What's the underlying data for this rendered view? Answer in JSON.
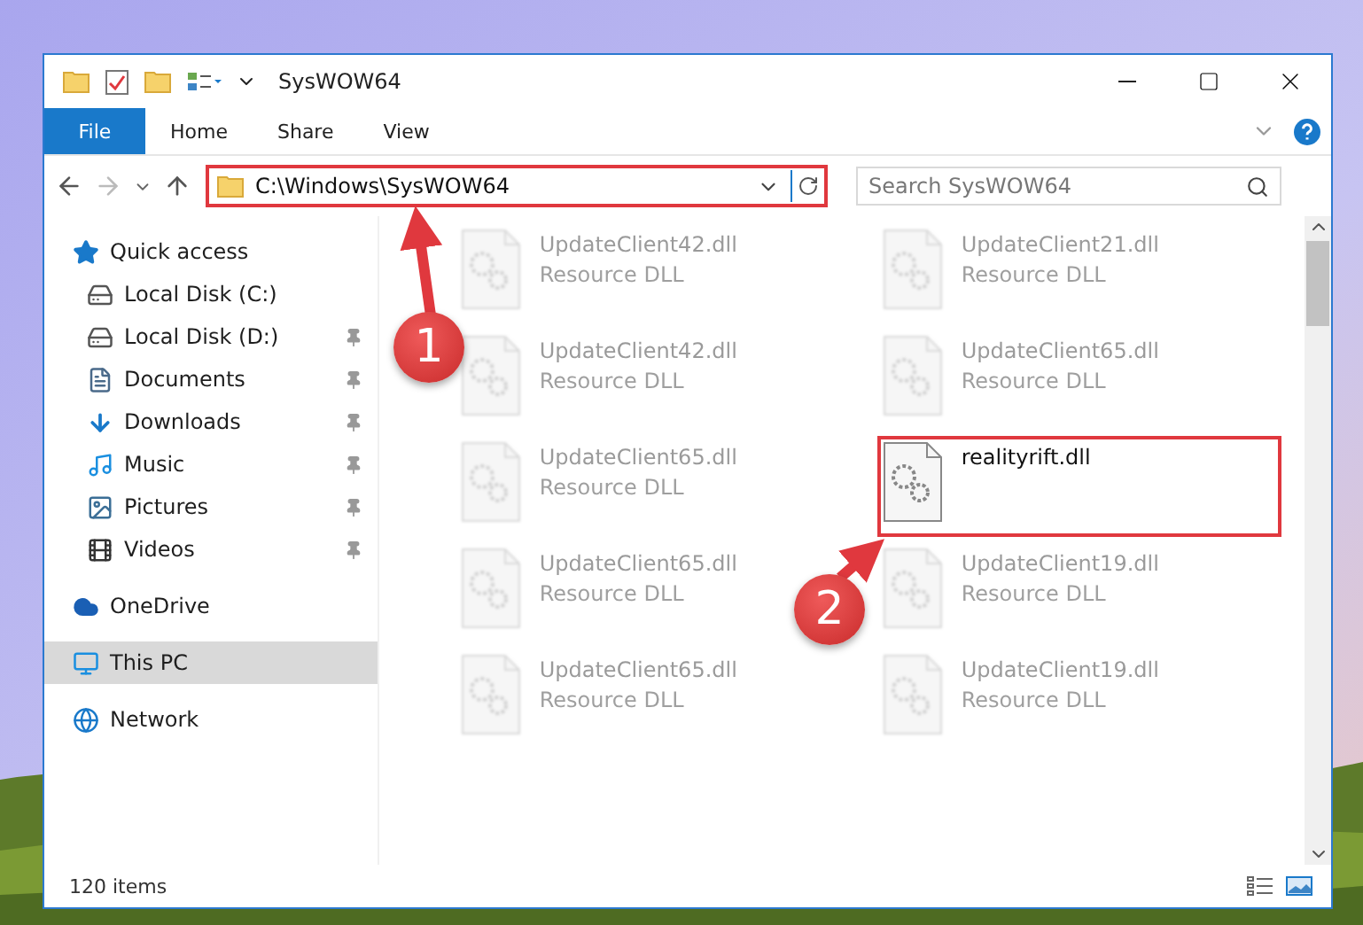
{
  "window": {
    "title": "SysWOW64"
  },
  "ribbon": {
    "file_button": "File",
    "tabs": [
      {
        "label": "Home",
        "selected": false
      },
      {
        "label": "Share",
        "selected": false
      },
      {
        "label": "View",
        "selected": false
      }
    ]
  },
  "address": {
    "path": "C:\\Windows\\SysWOW64",
    "highlighted": true
  },
  "search": {
    "placeholder": "Search SysWOW64"
  },
  "nav": [
    {
      "label": "Quick access",
      "kind": "star",
      "selected": false,
      "children": [
        {
          "label": "Local Disk (C:)",
          "kind": "drive",
          "pinned": false,
          "selected": false
        },
        {
          "label": "Local Disk (D:)",
          "kind": "drive",
          "pinned": true,
          "selected": false
        },
        {
          "label": "Documents",
          "kind": "documents",
          "pinned": true,
          "selected": false
        },
        {
          "label": "Downloads",
          "kind": "downloads",
          "pinned": true,
          "selected": false
        },
        {
          "label": "Music",
          "kind": "music",
          "pinned": true,
          "selected": false
        },
        {
          "label": "Pictures",
          "kind": "pictures",
          "pinned": true,
          "selected": false
        },
        {
          "label": "Videos",
          "kind": "videos",
          "pinned": true,
          "selected": false
        }
      ]
    },
    {
      "label": "OneDrive",
      "kind": "cloud",
      "selected": false
    },
    {
      "label": "This PC",
      "kind": "computer",
      "selected": true
    },
    {
      "label": "Network",
      "kind": "network",
      "selected": false
    }
  ],
  "files": [
    {
      "name": "UpdateClient42.dll",
      "type": "Resource DLL",
      "blurred": true,
      "highlighted": false
    },
    {
      "name": "UpdateClient21.dll",
      "type": "Resource DLL",
      "blurred": true,
      "highlighted": false
    },
    {
      "name": "UpdateClient42.dll",
      "type": "Resource DLL",
      "blurred": true,
      "highlighted": false
    },
    {
      "name": "UpdateClient65.dll",
      "type": "Resource DLL",
      "blurred": true,
      "highlighted": false
    },
    {
      "name": "UpdateClient65.dll",
      "type": "Resource DLL",
      "blurred": true,
      "highlighted": false
    },
    {
      "name": "realityrift.dll",
      "blurred": false,
      "highlighted": true
    },
    {
      "name": "UpdateClient65.dll",
      "type": "Resource DLL",
      "blurred": true,
      "highlighted": false
    },
    {
      "name": "UpdateClient19.dll",
      "type": "Resource DLL",
      "blurred": true,
      "highlighted": false
    },
    {
      "name": "UpdateClient65.dll",
      "type": "Resource DLL",
      "blurred": true,
      "highlighted": false
    },
    {
      "name": "UpdateClient19.dll",
      "type": "Resource DLL",
      "blurred": true,
      "highlighted": false
    }
  ],
  "status_bar": {
    "item_count": "120 items"
  },
  "annotations": [
    {
      "label": "1"
    },
    {
      "label": "2"
    }
  ]
}
